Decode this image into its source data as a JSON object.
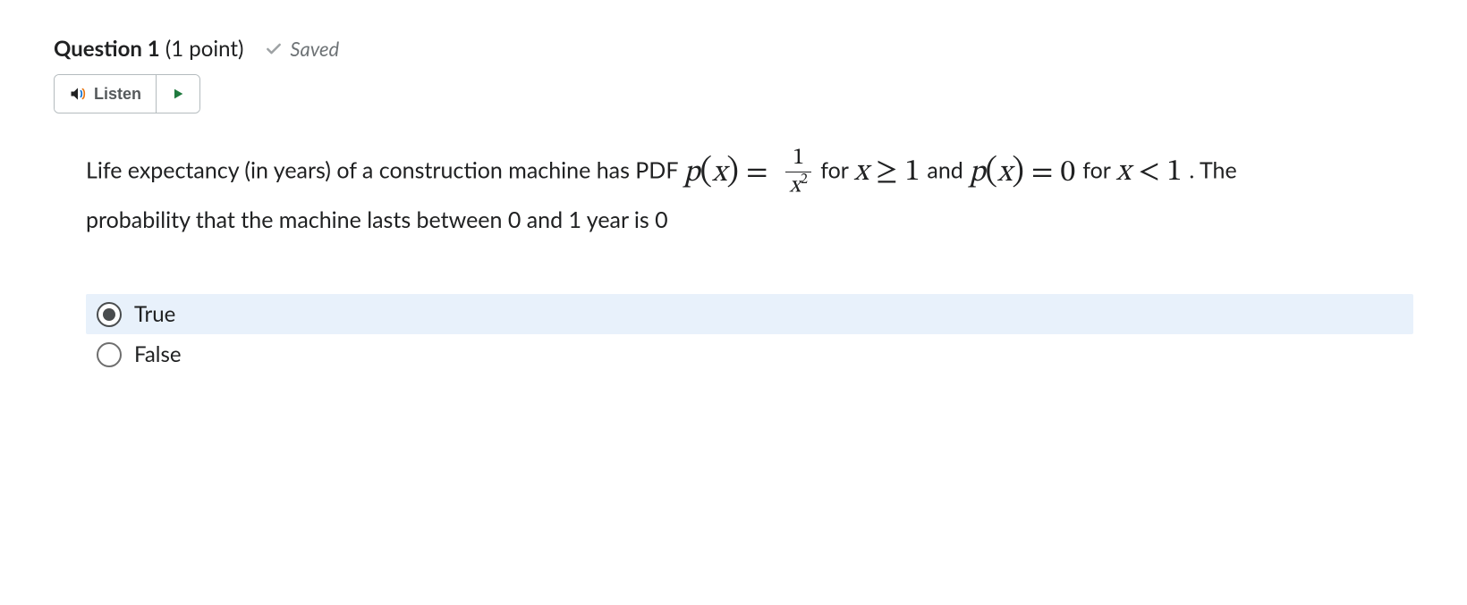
{
  "header": {
    "question_label": "Question",
    "question_number": "1",
    "points_text": "(1 point)",
    "saved_text": "Saved"
  },
  "listen": {
    "label": "Listen"
  },
  "question": {
    "t1": "Life expectancy (in years) of a construction machine has PDF ",
    "pdf_px": "p",
    "pdf_x": "x",
    "frac_top": "1",
    "frac_x": "x",
    "frac_exp": "2",
    "t_for": " for ",
    "cond1_lhs": "x",
    "cond1_op": "≥",
    "cond1_rhs": "1",
    "t_and": " and ",
    "zero": "0",
    "t_for2": "  for ",
    "cond2_lhs": "x",
    "cond2_op": "<",
    "cond2_rhs": "1",
    "t_period": ". ",
    "t2": "The probability that the machine lasts between 0 and 1 year is 0"
  },
  "options": {
    "a": "True",
    "b": "False"
  }
}
